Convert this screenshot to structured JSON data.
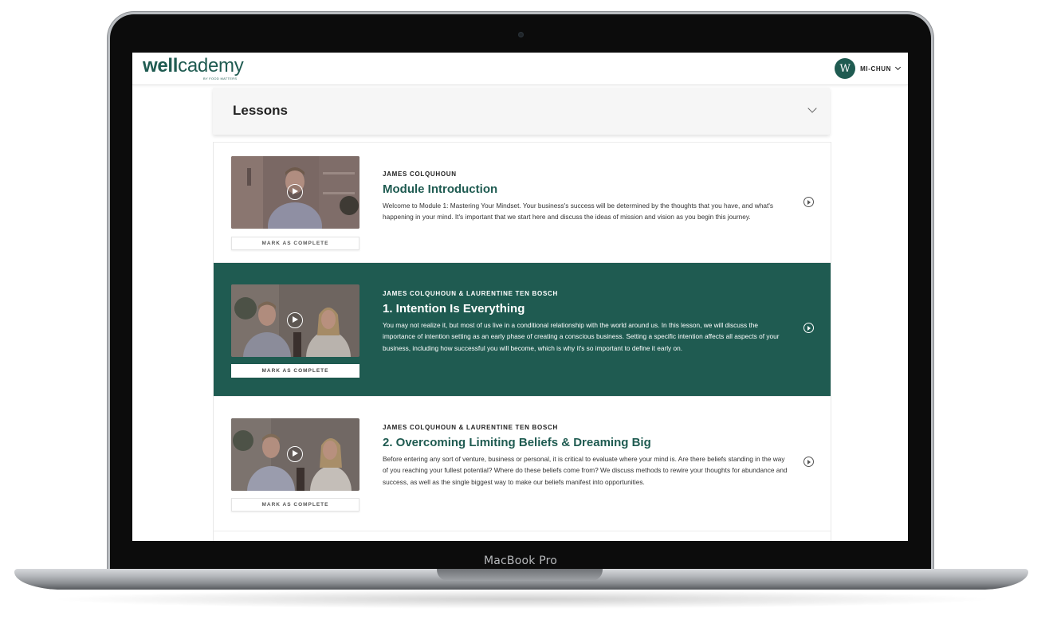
{
  "device": {
    "label": "MacBook Pro"
  },
  "header": {
    "logo_bold": "well",
    "logo_light": "cademy",
    "logo_tagline": "BY FOOD MATTERS",
    "user_initial": "W",
    "user_name": "MI-CHUN"
  },
  "section": {
    "title": "Lessons"
  },
  "lessons": [
    {
      "author": "JAMES COLQUHOUN",
      "title": "Module Introduction",
      "description": "Welcome to Module 1: Mastering Your Mindset. Your business's success will be determined by the thoughts that you have, and what's happening in your mind. It's important that we start here and discuss the ideas of mission and vision as you begin this journey.",
      "mark_label": "MARK AS COMPLETE",
      "active": false
    },
    {
      "author": "JAMES COLQUHOUN & LAURENTINE TEN BOSCH",
      "title": "1. Intention Is Everything",
      "description": "You may not realize it, but most of us live in a conditional relationship with the world around us. In this lesson, we will discuss the importance of intention setting as an early phase of creating a conscious business. Setting a specific intention affects all aspects of your business, including how successful you will become, which is why it's so important to define it early on.",
      "mark_label": "MARK AS COMPLETE",
      "active": true
    },
    {
      "author": "JAMES COLQUHOUN & LAURENTINE TEN BOSCH",
      "title": "2. Overcoming Limiting Beliefs & Dreaming Big",
      "description": "Before entering any sort of venture, business or personal, it is critical to evaluate where your mind is. Are there beliefs standing in the way of you reaching your fullest potential? Where do these beliefs come from? We discuss methods to rewire your thoughts for abundance and success, as well as the single biggest way to make our beliefs manifest into opportunities.",
      "mark_label": "MARK AS COMPLETE",
      "active": false
    }
  ],
  "colors": {
    "brand_green": "#1f5b51",
    "active_row_bg": "#1f5b51"
  }
}
